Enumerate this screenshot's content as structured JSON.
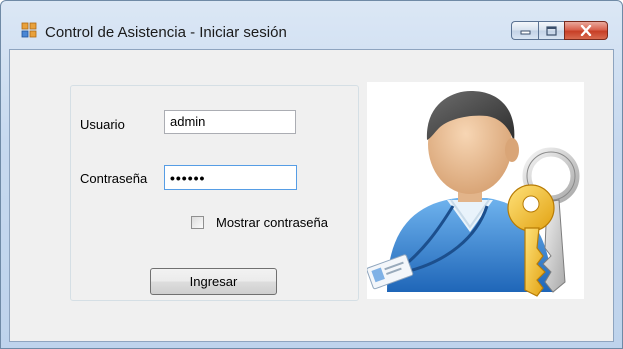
{
  "window": {
    "title": "Control de Asistencia - Iniciar sesión",
    "icon": "app-windows-form-icon",
    "buttons": [
      "minimize-icon",
      "maximize-icon",
      "close-icon"
    ]
  },
  "form": {
    "user_label": "Usuario",
    "user_value": "admin",
    "password_label": "Contraseña",
    "password_value": "••••••",
    "show_password_label": "Mostrar contraseña",
    "show_password_checked": false,
    "login_button": "Ingresar"
  },
  "picture": {
    "icon": "user-with-keys-icon"
  },
  "colors": {
    "title_bar": "#c7d9ef",
    "client_background": "#f0f0f0",
    "close_button": "#c73f26",
    "focused_border": "#569de5",
    "shirt_blue": "#2f7fd0",
    "key_yellow": "#f2b928"
  }
}
